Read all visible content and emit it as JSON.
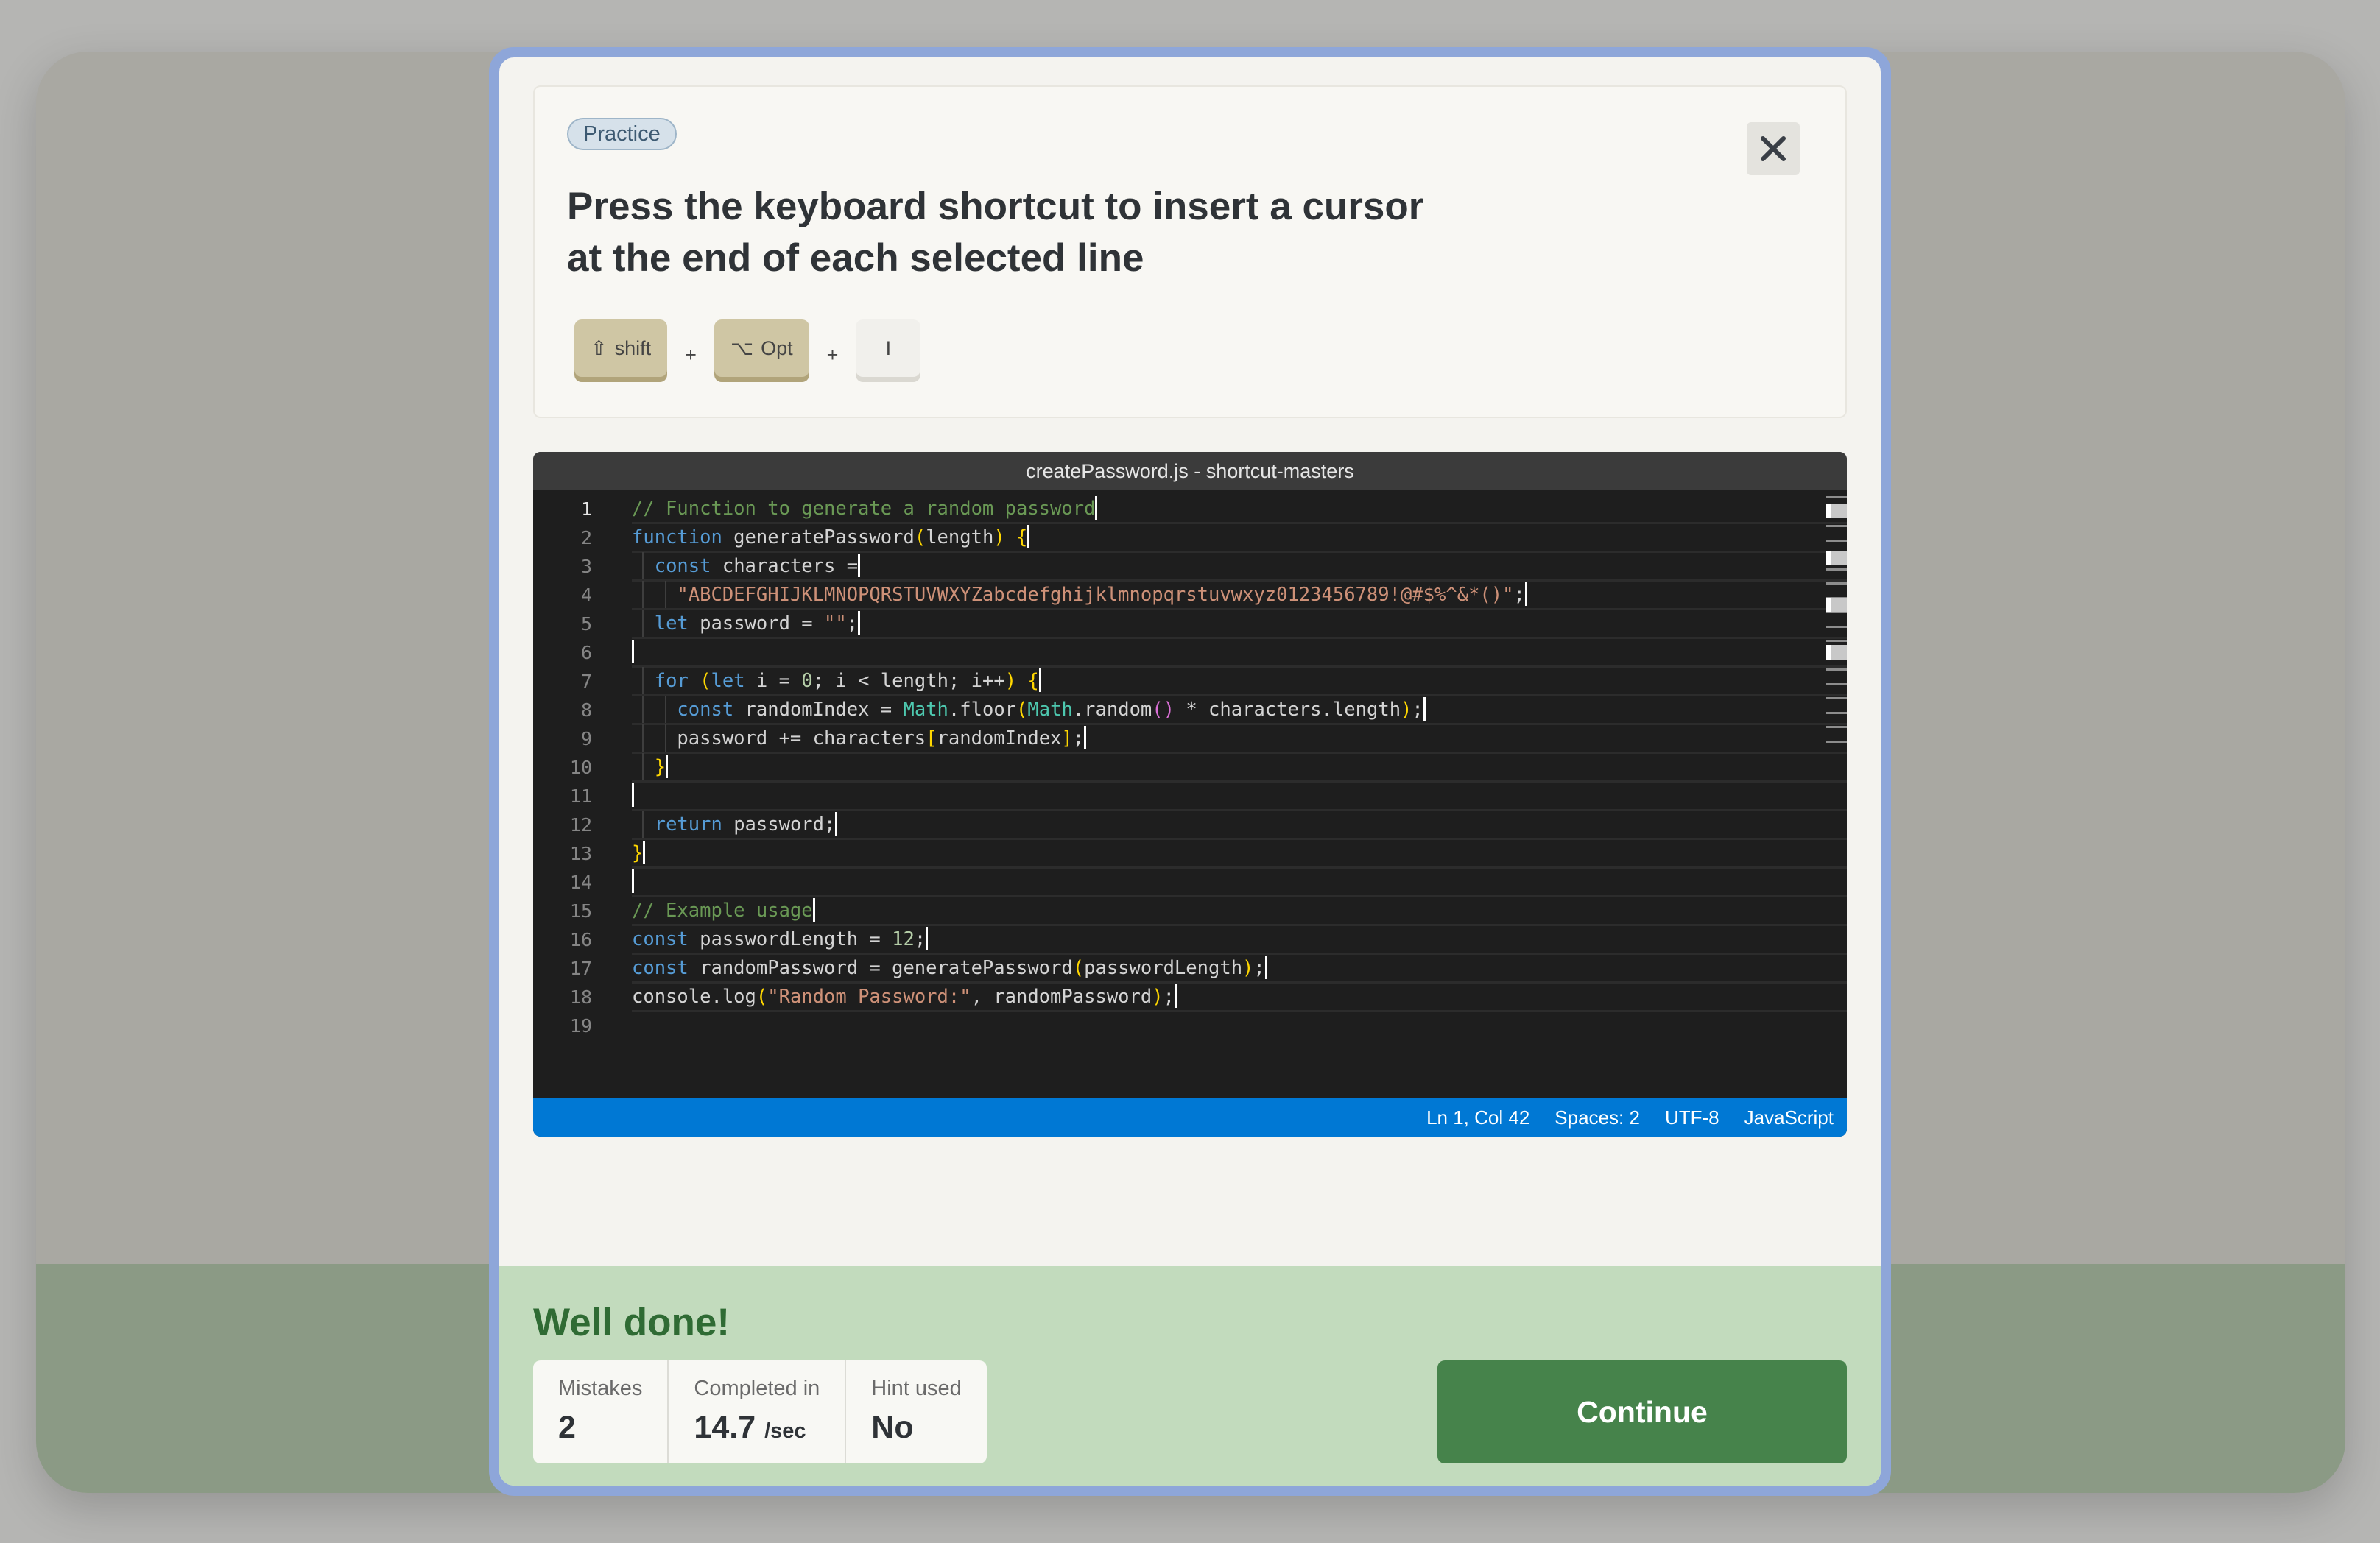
{
  "header": {
    "badge": "Practice",
    "title": "Press the keyboard shortcut to insert a cursor at the end of each selected line",
    "close_icon": "close-icon",
    "keys": [
      {
        "glyph": "⇧",
        "label": "shift",
        "pressed": true
      },
      {
        "glyph": "⌥",
        "label": "Opt",
        "pressed": true
      },
      {
        "glyph": "",
        "label": "I",
        "pressed": false
      }
    ],
    "plus": "+"
  },
  "editor": {
    "title": "createPassword.js - shortcut-masters",
    "line_numbers": [
      "1",
      "2",
      "3",
      "4",
      "5",
      "6",
      "7",
      "8",
      "9",
      "10",
      "11",
      "12",
      "13",
      "14",
      "15",
      "16",
      "17",
      "18",
      "19"
    ],
    "lines": [
      "// Function to generate a random password",
      "function generatePassword(length) {",
      "  const characters =",
      "    \"ABCDEFGHIJKLMNOPQRSTUVWXYZabcdefghijklmnopqrstuvwxyz0123456789!@#$%^&*()\";",
      "  let password = \"\";",
      "",
      "  for (let i = 0; i < length; i++) {",
      "    const randomIndex = Math.floor(Math.random() * characters.length);",
      "    password += characters[randomIndex];",
      "  }",
      "",
      "  return password;",
      "}",
      "",
      "// Example usage",
      "const passwordLength = 12;",
      "const randomPassword = generatePassword(passwordLength);",
      "console.log(\"Random Password:\", randomPassword);",
      ""
    ],
    "status": {
      "position": "Ln 1, Col 42",
      "spaces": "Spaces: 2",
      "encoding": "UTF-8",
      "language": "JavaScript"
    }
  },
  "result": {
    "title": "Well done!",
    "stats": [
      {
        "label": "Mistakes",
        "value": "2",
        "unit": ""
      },
      {
        "label": "Completed in",
        "value": "14.7",
        "unit": "/sec"
      },
      {
        "label": "Hint used",
        "value": "No",
        "unit": ""
      }
    ],
    "continue_label": "Continue"
  },
  "colors": {
    "accent_blue": "#0078d4",
    "success_green": "#46834b",
    "modal_border": "#8ea6d9"
  }
}
